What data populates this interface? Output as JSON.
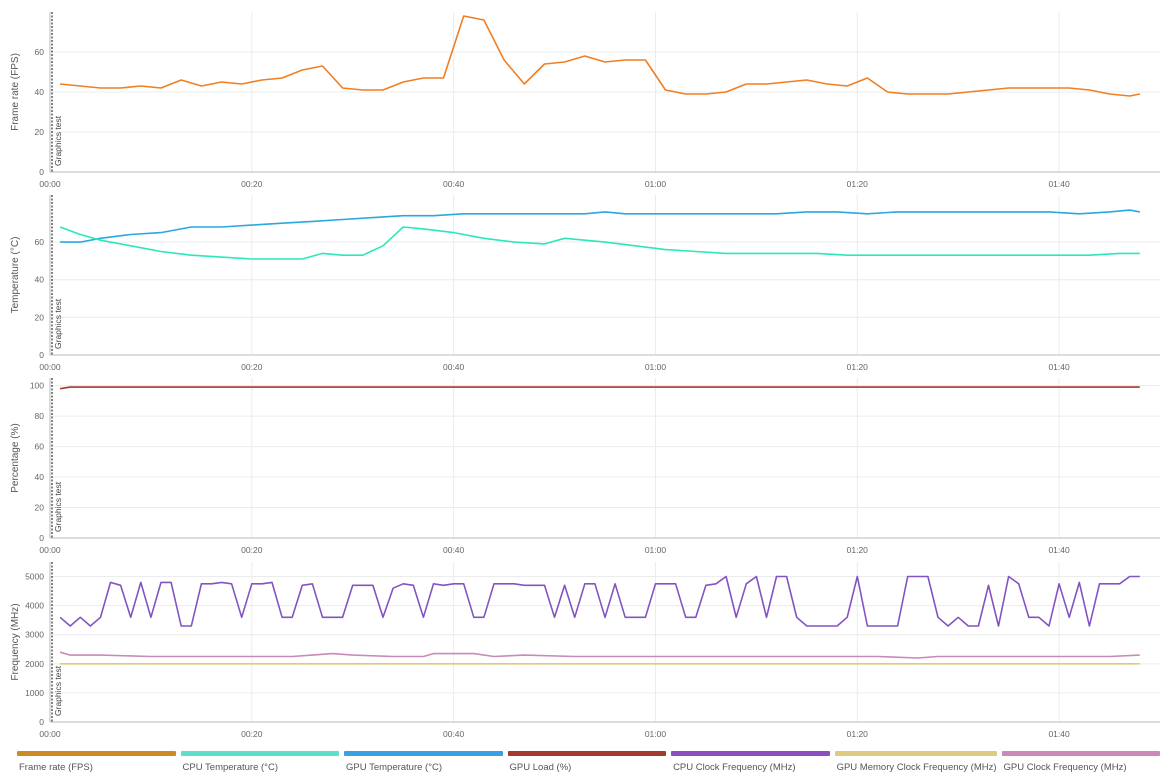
{
  "annotation_label": "Graphics test",
  "x_tick_labels": [
    "00:00",
    "00:20",
    "00:40",
    "01:00",
    "01:20",
    "01:40"
  ],
  "chart_data": [
    {
      "type": "line",
      "ylabel": "Frame rate (FPS)",
      "xlim": [
        0,
        110
      ],
      "ylim": [
        0,
        80
      ],
      "y_ticks": [
        0,
        20,
        40,
        60
      ],
      "x_ticks": [
        0,
        20,
        40,
        60,
        80,
        100
      ],
      "grid": true,
      "series": [
        {
          "name": "Frame rate (FPS)",
          "color": "#f07f23",
          "x": [
            1,
            3,
            5,
            7,
            9,
            11,
            13,
            15,
            17,
            19,
            21,
            23,
            25,
            27,
            29,
            31,
            33,
            35,
            37,
            39,
            41,
            43,
            45,
            47,
            49,
            51,
            53,
            55,
            57,
            59,
            61,
            63,
            65,
            67,
            69,
            71,
            73,
            75,
            77,
            79,
            81,
            83,
            85,
            87,
            89,
            91,
            93,
            95,
            97,
            99,
            101,
            103,
            105,
            107,
            108
          ],
          "y": [
            44,
            43,
            42,
            42,
            43,
            42,
            46,
            43,
            45,
            44,
            46,
            47,
            51,
            53,
            42,
            41,
            41,
            45,
            47,
            47,
            78,
            76,
            56,
            44,
            54,
            55,
            58,
            55,
            56,
            56,
            41,
            39,
            39,
            40,
            44,
            44,
            45,
            46,
            44,
            43,
            47,
            40,
            39,
            39,
            39,
            40,
            41,
            42,
            42,
            42,
            42,
            41,
            39,
            38,
            39
          ]
        }
      ]
    },
    {
      "type": "line",
      "ylabel": "Temperature (°C)",
      "xlim": [
        0,
        110
      ],
      "ylim": [
        0,
        85
      ],
      "y_ticks": [
        0,
        20,
        40,
        60
      ],
      "x_ticks": [
        0,
        20,
        40,
        60,
        80,
        100
      ],
      "grid": true,
      "series": [
        {
          "name": "GPU Temperature (°C)",
          "color": "#2aa8e0",
          "x": [
            1,
            3,
            5,
            8,
            11,
            14,
            17,
            20,
            23,
            26,
            29,
            32,
            35,
            38,
            41,
            44,
            47,
            50,
            53,
            55,
            57,
            60,
            63,
            66,
            69,
            72,
            75,
            78,
            81,
            84,
            87,
            90,
            93,
            96,
            99,
            102,
            105,
            107,
            108
          ],
          "y": [
            60,
            60,
            62,
            64,
            65,
            68,
            68,
            69,
            70,
            71,
            72,
            73,
            74,
            74,
            75,
            75,
            75,
            75,
            75,
            76,
            75,
            75,
            75,
            75,
            75,
            75,
            76,
            76,
            75,
            76,
            76,
            76,
            76,
            76,
            76,
            75,
            76,
            77,
            76
          ]
        },
        {
          "name": "CPU Temperature (°C)",
          "color": "#2ce8b8",
          "x": [
            1,
            3,
            5,
            8,
            11,
            14,
            17,
            20,
            23,
            25,
            27,
            29,
            31,
            33,
            34,
            35,
            37,
            40,
            43,
            46,
            49,
            51,
            53,
            55,
            58,
            61,
            64,
            67,
            70,
            73,
            76,
            79,
            82,
            85,
            88,
            91,
            94,
            97,
            100,
            103,
            106,
            108
          ],
          "y": [
            68,
            64,
            61,
            58,
            55,
            53,
            52,
            51,
            51,
            51,
            54,
            53,
            53,
            58,
            63,
            68,
            67,
            65,
            62,
            60,
            59,
            62,
            61,
            60,
            58,
            56,
            55,
            54,
            54,
            54,
            54,
            53,
            53,
            53,
            53,
            53,
            53,
            53,
            53,
            53,
            54,
            54
          ]
        }
      ]
    },
    {
      "type": "line",
      "ylabel": "Percentage (%)",
      "xlim": [
        0,
        110
      ],
      "ylim": [
        0,
        105
      ],
      "y_ticks": [
        0,
        20,
        40,
        60,
        80,
        100
      ],
      "x_ticks": [
        0,
        20,
        40,
        60,
        80,
        100
      ],
      "grid": true,
      "series": [
        {
          "name": "GPU Load (%)",
          "color": "#a23b2c",
          "x": [
            1,
            2,
            4,
            108
          ],
          "y": [
            98,
            99,
            99,
            99
          ]
        }
      ]
    },
    {
      "type": "line",
      "ylabel": "Frequency (MHz)",
      "xlim": [
        0,
        110
      ],
      "ylim": [
        0,
        5500
      ],
      "y_ticks": [
        0,
        1000,
        2000,
        3000,
        4000,
        5000
      ],
      "x_ticks": [
        0,
        20,
        40,
        60,
        80,
        100
      ],
      "grid": true,
      "series": [
        {
          "name": "CPU Clock Frequency (MHz)",
          "color": "#8254c2",
          "x": [
            1,
            2,
            3,
            4,
            5,
            6,
            7,
            8,
            9,
            10,
            11,
            12,
            13,
            14,
            15,
            16,
            17,
            18,
            19,
            20,
            21,
            22,
            23,
            24,
            25,
            26,
            27,
            28,
            29,
            30,
            31,
            32,
            33,
            34,
            35,
            36,
            37,
            38,
            39,
            40,
            41,
            42,
            43,
            44,
            45,
            46,
            47,
            48,
            49,
            50,
            51,
            52,
            53,
            54,
            55,
            56,
            57,
            58,
            59,
            60,
            61,
            62,
            63,
            64,
            65,
            66,
            67,
            68,
            69,
            70,
            71,
            72,
            73,
            74,
            75,
            76,
            77,
            78,
            79,
            80,
            81,
            82,
            83,
            84,
            85,
            86,
            87,
            88,
            89,
            90,
            91,
            92,
            93,
            94,
            95,
            96,
            97,
            98,
            99,
            100,
            101,
            102,
            103,
            104,
            105,
            106,
            107,
            108
          ],
          "y": [
            3600,
            3300,
            3600,
            3300,
            3600,
            4800,
            4700,
            3600,
            4800,
            3600,
            4800,
            4800,
            3300,
            3300,
            4750,
            4750,
            4800,
            4750,
            3600,
            4750,
            4750,
            4800,
            3600,
            3600,
            4700,
            4750,
            3600,
            3600,
            3600,
            4700,
            4700,
            4700,
            3600,
            4600,
            4750,
            4700,
            3600,
            4750,
            4700,
            4750,
            4750,
            3600,
            3600,
            4750,
            4750,
            4750,
            4700,
            4700,
            4700,
            3600,
            4700,
            3600,
            4750,
            4750,
            3600,
            4750,
            3600,
            3600,
            3600,
            4750,
            4750,
            4750,
            3600,
            3600,
            4700,
            4750,
            5000,
            3600,
            4750,
            5000,
            3600,
            5000,
            5000,
            3600,
            3300,
            3300,
            3300,
            3300,
            3600,
            5000,
            3300,
            3300,
            3300,
            3300,
            5000,
            5000,
            5000,
            3600,
            3300,
            3600,
            3300,
            3300,
            4700,
            3300,
            5000,
            4750,
            3600,
            3600,
            3300,
            4750,
            3600,
            4800,
            3300,
            4750,
            4750,
            4750,
            5000,
            5000
          ]
        },
        {
          "name": "GPU Memory Clock Frequency (MHz)",
          "color": "#e0c97a",
          "x": [
            1,
            108
          ],
          "y": [
            2000,
            2000
          ]
        },
        {
          "name": "GPU Clock Frequency (MHz)",
          "color": "#c88ab6",
          "x": [
            1,
            2,
            5,
            10,
            15,
            20,
            24,
            26,
            28,
            30,
            34,
            37,
            38,
            42,
            44,
            47,
            52,
            58,
            62,
            68,
            75,
            82,
            86,
            88,
            92,
            96,
            100,
            105,
            108
          ],
          "y": [
            2400,
            2300,
            2300,
            2250,
            2250,
            2250,
            2250,
            2300,
            2350,
            2300,
            2250,
            2250,
            2350,
            2350,
            2250,
            2300,
            2250,
            2250,
            2250,
            2250,
            2250,
            2250,
            2200,
            2250,
            2250,
            2250,
            2250,
            2250,
            2300
          ]
        }
      ]
    }
  ],
  "legend": [
    {
      "label": "Frame rate (FPS)",
      "color": "#cd8a27"
    },
    {
      "label": "CPU Temperature (°C)",
      "color": "#5ce0cc"
    },
    {
      "label": "GPU Temperature (°C)",
      "color": "#3aa0e6"
    },
    {
      "label": "GPU Load (%)",
      "color": "#a33a2f"
    },
    {
      "label": "CPU Clock Frequency (MHz)",
      "color": "#8a4fc0"
    },
    {
      "label": "GPU Memory Clock Frequency (MHz)",
      "color": "#dfca82"
    },
    {
      "label": "GPU Clock Frequency (MHz)",
      "color": "#c98ab8"
    }
  ]
}
